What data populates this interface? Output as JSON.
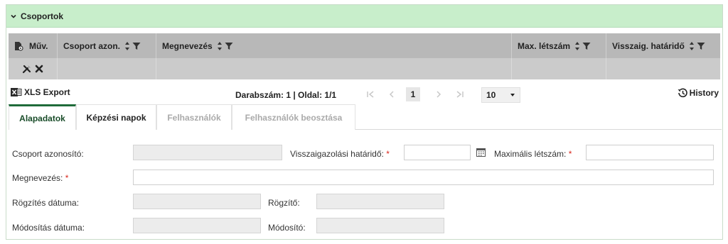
{
  "panel": {
    "title": "Csoportok",
    "accent": "#c8eecb",
    "tab_accent": "#1f6b3a",
    "required_color": "#d9261c"
  },
  "grid": {
    "columns": [
      {
        "key": "muv",
        "label": "Műv.",
        "icon": "document-gear-icon"
      },
      {
        "key": "csoport_azon",
        "label": "Csoport azon."
      },
      {
        "key": "megnevezes",
        "label": "Megnevezés"
      },
      {
        "key": "max_letszam",
        "label": "Max. létszám"
      },
      {
        "key": "visszaig_hatarido",
        "label": "Visszaig. határidő"
      }
    ],
    "row_actions": [
      "tools-icon",
      "close-icon"
    ]
  },
  "toolbar": {
    "export_label": "XLS Export",
    "record_info": "Darabszám: 1 | Oldal: 1/1",
    "current_page": "1",
    "page_size": "10",
    "history_label": "History"
  },
  "tabs": [
    {
      "label": "Alapadatok",
      "state": "active"
    },
    {
      "label": "Képzési napok",
      "state": "enabled"
    },
    {
      "label": "Felhasználók",
      "state": "disabled"
    },
    {
      "label": "Felhasználók beosztása",
      "state": "disabled"
    }
  ],
  "form": {
    "csoport_azonosito": {
      "label": "Csoport azonosító:",
      "value": ""
    },
    "visszaigazolasi_hatarido": {
      "label": "Visszaigazolási határidő:",
      "required_mark": "*",
      "value": ""
    },
    "maximalis_letszam": {
      "label": "Maximális létszám:",
      "required_mark": "*",
      "value": ""
    },
    "megnevezes": {
      "label": "Megnevezés:",
      "required_mark": "*",
      "value": ""
    },
    "rogzites_datuma": {
      "label": "Rögzítés dátuma:",
      "value": ""
    },
    "rogzito": {
      "label": "Rögzítő:",
      "value": ""
    },
    "modositas_datuma": {
      "label": "Módosítás dátuma:",
      "value": ""
    },
    "modosito": {
      "label": "Módosító:",
      "value": ""
    }
  }
}
